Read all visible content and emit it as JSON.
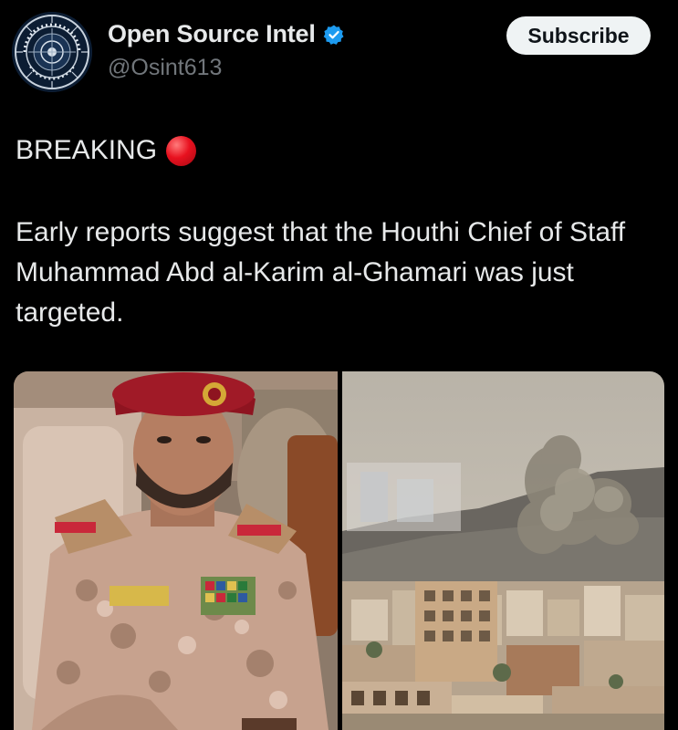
{
  "author": {
    "display_name": "Open Source Intel",
    "handle": "@Osint613",
    "verified": true,
    "avatar_icon": "osint-seal-logo",
    "avatar_lettering": "OPEN SOURCE INTEL"
  },
  "actions": {
    "subscribe_label": "Subscribe"
  },
  "post": {
    "breaking_label": "BREAKING",
    "breaking_emoji": "red-circle",
    "body": "Early reports suggest that the Houthi Chief of Staff Muhammad Abd al-Karim al-Ghamari was just targeted."
  },
  "media": [
    {
      "kind": "photo",
      "subject": "officer-portrait"
    },
    {
      "kind": "photo",
      "subject": "city-smoke-plume"
    }
  ],
  "colors": {
    "background": "#000000",
    "text_primary": "#e7e9ea",
    "text_secondary": "#71767b",
    "verified_blue": "#1d9bf0",
    "subscribe_bg": "#eff3f4",
    "breaking_red": "#e8111f"
  }
}
